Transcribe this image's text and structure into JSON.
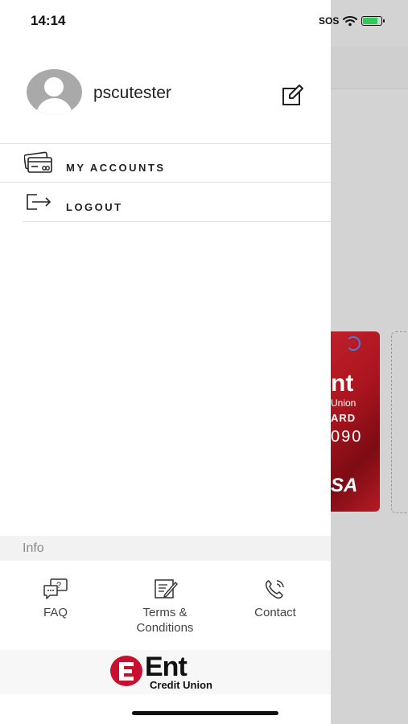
{
  "status_bar": {
    "time": "14:14",
    "sos": "SOS"
  },
  "profile": {
    "username": "pscutester"
  },
  "menu": {
    "items": [
      {
        "label": "MY ACCOUNTS",
        "icon": "cards-icon"
      },
      {
        "label": "LOGOUT",
        "icon": "logout-icon"
      }
    ]
  },
  "info": {
    "header": "Info",
    "items": [
      {
        "label": "FAQ",
        "icon": "faq-icon"
      },
      {
        "label": "Terms &\nConditions",
        "icon": "terms-icon"
      },
      {
        "label": "Contact",
        "icon": "phone-icon"
      }
    ]
  },
  "logo": {
    "name": "Ent",
    "sub": "Credit Union",
    "color": "#c8102e"
  },
  "background_card": {
    "brand": "nt",
    "sub": "Union",
    "type": "ARD",
    "number": "090",
    "network": "SA"
  }
}
